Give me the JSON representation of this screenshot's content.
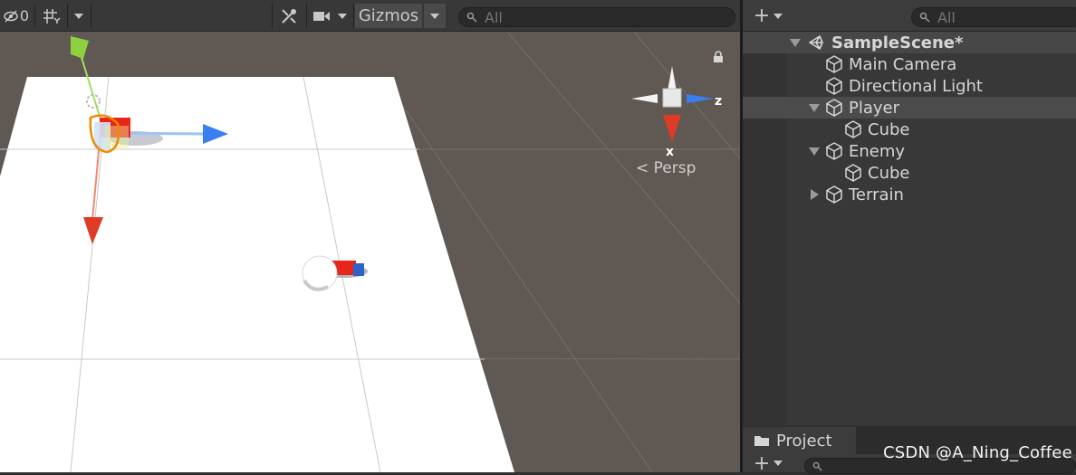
{
  "scene_toolbar": {
    "visibility_count": "0",
    "gizmos_label": "Gizmos",
    "search_placeholder": "All"
  },
  "scene_view": {
    "persp_label": "Persp",
    "axis_x_label": "x",
    "axis_z_label": "z"
  },
  "hierarchy": {
    "search_placeholder": "All",
    "scene_name": "SampleScene*",
    "items": [
      {
        "label": "Main Camera",
        "expanded": null
      },
      {
        "label": "Directional Light",
        "expanded": null
      },
      {
        "label": "Player",
        "expanded": true,
        "selected": true
      },
      {
        "label": "Cube",
        "expanded": null
      },
      {
        "label": "Enemy",
        "expanded": true
      },
      {
        "label": "Cube",
        "expanded": null
      },
      {
        "label": "Terrain",
        "expanded": false
      }
    ]
  },
  "project": {
    "tab_label": "Project"
  },
  "watermark": "CSDN @A_Ning_Coffee",
  "colors": {
    "scene_background": "#5f5853",
    "ground": "#ffffff",
    "gizmo_x": "#e03b24",
    "gizmo_y": "#8fd03f",
    "gizmo_z": "#3a7ff0",
    "selection_outline": "#f08a00"
  }
}
